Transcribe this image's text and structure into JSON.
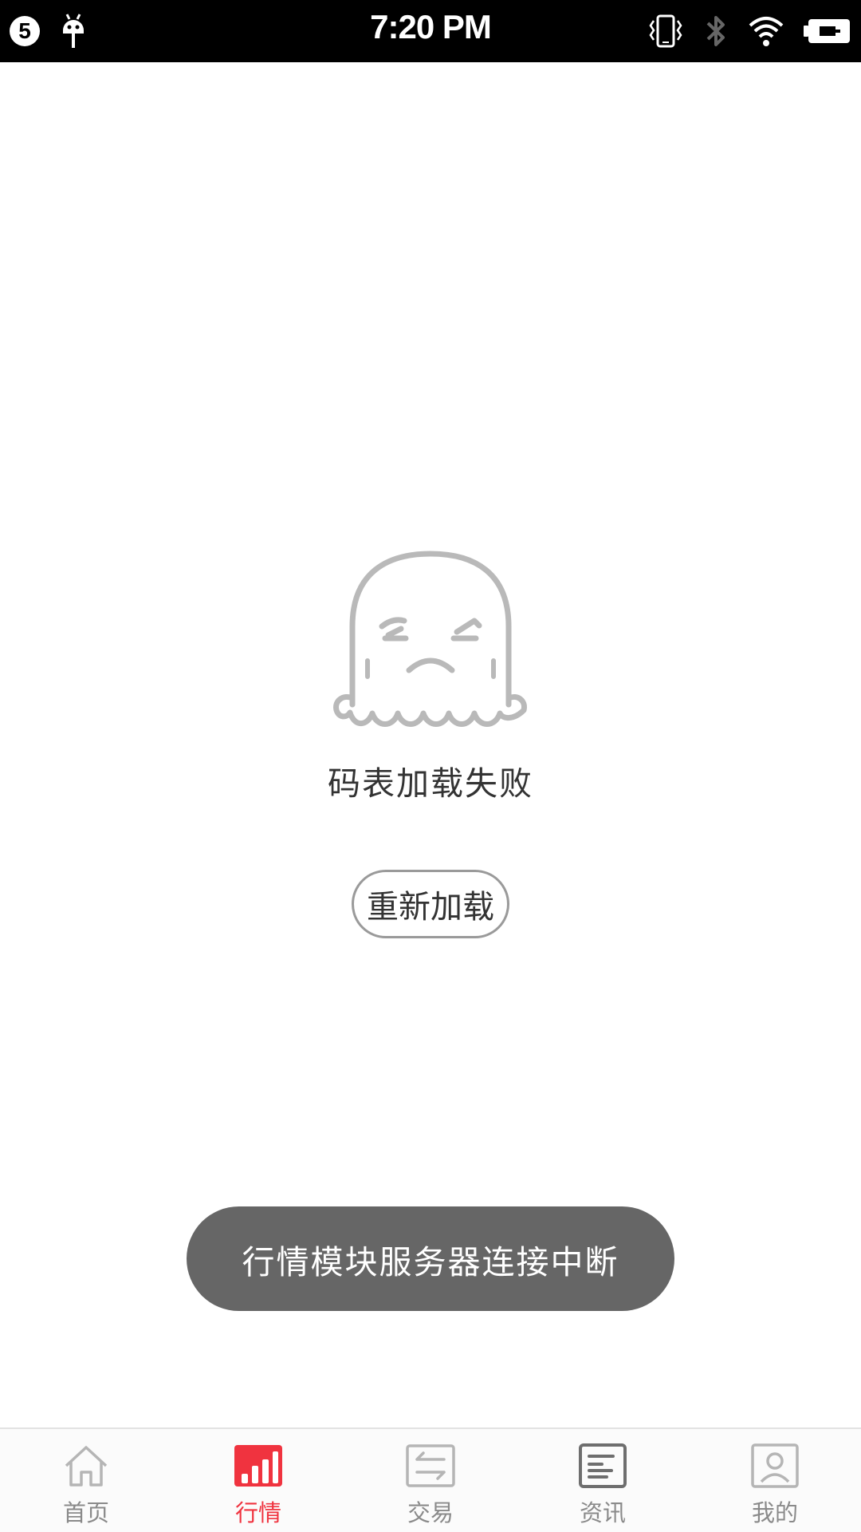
{
  "status_bar": {
    "notification_count": "5",
    "time": "7:20 PM",
    "icons": [
      "android-icon",
      "vibrate-icon",
      "bluetooth-icon",
      "wifi-icon",
      "battery-charging-icon"
    ]
  },
  "error_state": {
    "illustration": "sad-ghost-icon",
    "message": "码表加载失败",
    "reload_label": "重新加载"
  },
  "toast": {
    "message": "行情模块服务器连接中断"
  },
  "bottom_nav": {
    "active_color": "#f0333f",
    "inactive_color": "#8a8a8a",
    "items": [
      {
        "label": "首页",
        "icon": "home-icon",
        "active": false
      },
      {
        "label": "行情",
        "icon": "market-chart-icon",
        "active": true
      },
      {
        "label": "交易",
        "icon": "trade-arrows-icon",
        "active": false
      },
      {
        "label": "资讯",
        "icon": "news-icon",
        "active": false
      },
      {
        "label": "我的",
        "icon": "profile-icon",
        "active": false
      }
    ]
  }
}
